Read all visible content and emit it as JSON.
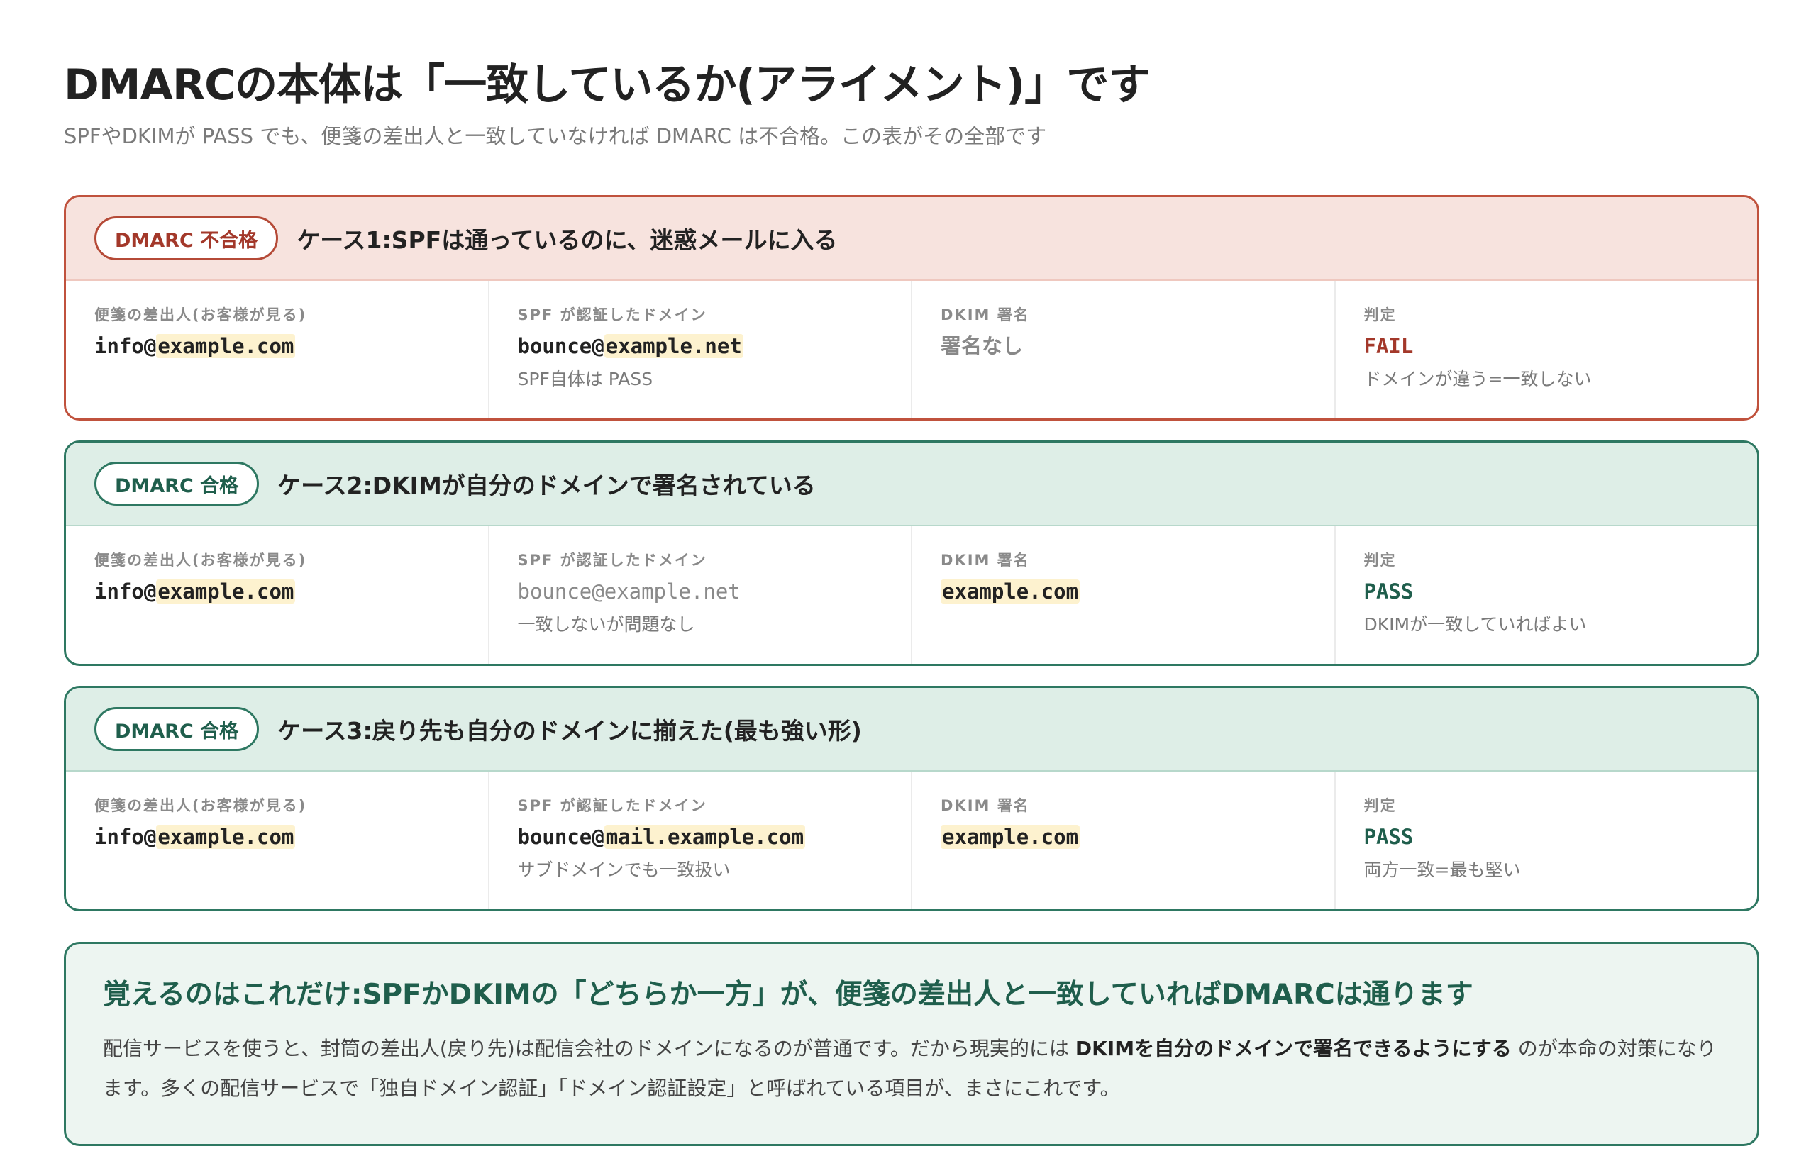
{
  "header": {
    "title": "DMARCの本体は「一致しているか(アライメント)」です",
    "subtitle": "SPFやDKIMが PASS でも、便箋の差出人と一致していなければ DMARC は不合格。この表がその全部です"
  },
  "columns": {
    "from": "便箋の差出人(お客様が見る)",
    "spf": "SPF が認証したドメイン",
    "dkim": "DKIM 署名",
    "verdict": "判定"
  },
  "cases": [
    {
      "status": "fail",
      "badge": "DMARC 不合格",
      "title": "ケース1:SPFは通っているのに、迷惑メールに入る",
      "from_local": "info@",
      "from_domain": "example.com",
      "spf_local": "bounce@",
      "spf_domain": "example.net",
      "spf_note": "SPF自体は PASS",
      "dkim_value": "署名なし",
      "verdict": "FAIL",
      "verdict_note": "ドメインが違う=一致しない"
    },
    {
      "status": "pass",
      "badge": "DMARC 合格",
      "title": "ケース2:DKIMが自分のドメインで署名されている",
      "from_local": "info@",
      "from_domain": "example.com",
      "spf_value": "bounce@example.net",
      "spf_note": "一致しないが問題なし",
      "dkim_value": "example.com",
      "verdict": "PASS",
      "verdict_note": "DKIMが一致していればよい"
    },
    {
      "status": "pass",
      "badge": "DMARC 合格",
      "title": "ケース3:戻り先も自分のドメインに揃えた(最も強い形)",
      "from_local": "info@",
      "from_domain": "example.com",
      "spf_local": "bounce@",
      "spf_domain": "mail.example.com",
      "spf_note": "サブドメインでも一致扱い",
      "dkim_value": "example.com",
      "verdict": "PASS",
      "verdict_note": "両方一致=最も堅い"
    }
  ],
  "summary": {
    "title": "覚えるのはこれだけ:SPFかDKIMの「どちらか一方」が、便箋の差出人と一致していればDMARCは通ります",
    "text_before": "配信サービスを使うと、封筒の差出人(戻り先)は配信会社のドメインになるのが普通です。だから現実的には ",
    "text_strong": "DKIMを自分のドメインで署名できるようにする",
    "text_after": " のが本命の対策になります。多くの配信サービスで「独自ドメイン認証」「ドメイン認証設定」と呼ばれている項目が、まさにこれです。"
  },
  "colors": {
    "fail": "#c0523d",
    "pass": "#2e7862",
    "highlight": "#fdf2cf"
  }
}
